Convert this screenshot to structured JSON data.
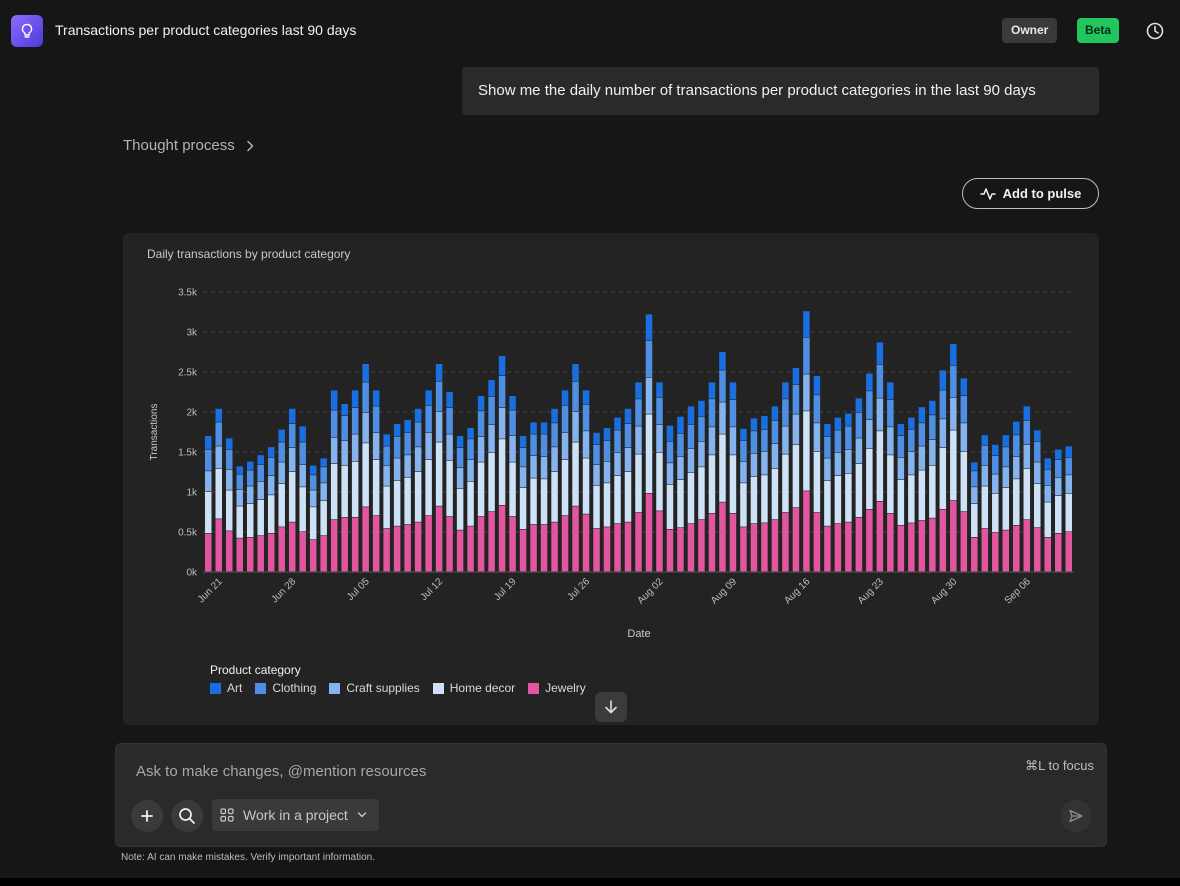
{
  "header": {
    "title": "Transactions per product categories last 90 days",
    "owner_badge": "Owner",
    "beta_badge": "Beta"
  },
  "conversation": {
    "user_message": "Show me the daily number of transactions per product categories in the last 90 days",
    "thought_process_label": "Thought process",
    "add_to_pulse_label": "Add to pulse"
  },
  "chart_data": {
    "type": "bar",
    "stacked": true,
    "title": "Daily transactions by product category",
    "xlabel": "Date",
    "ylabel": "Transactions",
    "ylim": [
      0,
      3500
    ],
    "yticks": [
      "0k",
      "0.5k",
      "1k",
      "1.5k",
      "2k",
      "2.5k",
      "3k",
      "3.5k"
    ],
    "ytick_values": [
      0,
      500,
      1000,
      1500,
      2000,
      2500,
      3000,
      3500
    ],
    "xtick_labels": [
      "Jun 21",
      "Jun 28",
      "Jul 05",
      "Jul 12",
      "Jul 19",
      "Jul 26",
      "Aug 02",
      "Aug 09",
      "Aug 16",
      "Aug 23",
      "Aug 30",
      "Sep 06"
    ],
    "xtick_indices": [
      1,
      8,
      15,
      22,
      29,
      36,
      43,
      50,
      57,
      64,
      71,
      78
    ],
    "grid": true,
    "legend_title": "Product category",
    "legend_position": "bottom-left",
    "colors": {
      "Art": "#1a6fe0",
      "Clothing": "#4e8fe3",
      "Craft supplies": "#84b3ee",
      "Home decor": "#cde1f7",
      "Jewelry": "#e2559f"
    },
    "totals": [
      1700,
      2040,
      1670,
      1320,
      1380,
      1460,
      1560,
      1780,
      2040,
      1820,
      1330,
      1420,
      2270,
      2100,
      2270,
      2600,
      2270,
      1720,
      1850,
      1900,
      2040,
      2270,
      2600,
      2250,
      1700,
      1800,
      2200,
      2400,
      2700,
      2200,
      1700,
      1870,
      1870,
      2040,
      2270,
      2600,
      2270,
      1740,
      1800,
      1930,
      2040,
      2370,
      3220,
      2370,
      1830,
      1940,
      2070,
      2140,
      2370,
      2750,
      2370,
      1790,
      1920,
      1950,
      2070,
      2370,
      2550,
      3260,
      2450,
      1850,
      1930,
      1980,
      2170,
      2480,
      2870,
      2370,
      1850,
      1930,
      2060,
      2140,
      2500,
      2850,
      2420,
      1370,
      1710,
      1590,
      1710,
      1880,
      2070,
      1770,
      1420,
      1530,
      1570
    ],
    "series": [
      {
        "name": "Jewelry",
        "values": [
          480,
          660,
          510,
          420,
          430,
          450,
          480,
          560,
          620,
          500,
          400,
          450,
          650,
          680,
          680,
          810,
          700,
          540,
          570,
          590,
          620,
          700,
          820,
          690,
          520,
          570,
          690,
          750,
          830,
          690,
          530,
          590,
          590,
          620,
          700,
          820,
          720,
          540,
          560,
          600,
          620,
          740,
          980,
          760,
          530,
          550,
          600,
          650,
          730,
          870,
          730,
          560,
          600,
          610,
          650,
          740,
          800,
          1010,
          740,
          570,
          600,
          620,
          680,
          780,
          880,
          730,
          580,
          610,
          640,
          670,
          780,
          890,
          750,
          430,
          540,
          490,
          520,
          580,
          650,
          550,
          430,
          480,
          500
        ]
      },
      {
        "name": "Home decor",
        "values": [
          520,
          630,
          510,
          400,
          420,
          450,
          480,
          540,
          630,
          560,
          410,
          440,
          700,
          650,
          700,
          800,
          700,
          530,
          570,
          590,
          630,
          700,
          800,
          700,
          520,
          560,
          680,
          740,
          830,
          680,
          520,
          580,
          570,
          630,
          700,
          800,
          700,
          540,
          550,
          600,
          630,
          730,
          990,
          730,
          560,
          600,
          640,
          660,
          730,
          850,
          730,
          550,
          590,
          600,
          640,
          730,
          790,
          1000,
          760,
          570,
          600,
          610,
          670,
          760,
          880,
          730,
          570,
          600,
          630,
          660,
          770,
          880,
          750,
          420,
          530,
          490,
          530,
          580,
          640,
          550,
          440,
          470,
          480
        ]
      },
      {
        "name": "Craft supplies",
        "values": [
          260,
          280,
          260,
          210,
          220,
          230,
          240,
          270,
          300,
          280,
          210,
          220,
          330,
          310,
          340,
          380,
          340,
          260,
          280,
          280,
          310,
          340,
          380,
          330,
          260,
          270,
          320,
          350,
          390,
          330,
          260,
          280,
          280,
          310,
          340,
          380,
          340,
          260,
          270,
          290,
          300,
          350,
          460,
          350,
          270,
          290,
          300,
          320,
          350,
          400,
          350,
          270,
          290,
          290,
          310,
          350,
          380,
          460,
          360,
          280,
          290,
          300,
          320,
          360,
          410,
          350,
          280,
          290,
          300,
          320,
          360,
          410,
          360,
          210,
          260,
          240,
          260,
          280,
          300,
          270,
          210,
          230,
          230
        ]
      },
      {
        "name": "Clothing",
        "values": [
          270,
          300,
          250,
          190,
          200,
          210,
          230,
          250,
          300,
          280,
          190,
          200,
          340,
          310,
          330,
          380,
          330,
          240,
          270,
          280,
          310,
          340,
          380,
          330,
          250,
          260,
          320,
          350,
          400,
          320,
          240,
          270,
          280,
          300,
          340,
          380,
          330,
          250,
          260,
          280,
          300,
          340,
          460,
          340,
          270,
          290,
          300,
          310,
          350,
          400,
          340,
          260,
          280,
          280,
          290,
          340,
          370,
          460,
          350,
          270,
          280,
          290,
          320,
          360,
          420,
          340,
          270,
          280,
          290,
          310,
          360,
          400,
          340,
          200,
          250,
          230,
          250,
          270,
          300,
          260,
          200,
          220,
          220
        ]
      },
      {
        "name": "Art",
        "values": [
          170,
          170,
          140,
          100,
          110,
          120,
          130,
          160,
          190,
          200,
          120,
          110,
          250,
          150,
          220,
          230,
          200,
          150,
          160,
          160,
          170,
          190,
          220,
          200,
          150,
          140,
          190,
          210,
          250,
          180,
          150,
          150,
          150,
          180,
          190,
          220,
          180,
          150,
          160,
          160,
          190,
          210,
          330,
          190,
          200,
          210,
          230,
          200,
          210,
          230,
          220,
          150,
          160,
          170,
          180,
          210,
          210,
          330,
          240,
          160,
          160,
          160,
          180,
          220,
          280,
          220,
          150,
          150,
          200,
          180,
          250,
          270,
          220,
          110,
          130,
          140,
          150,
          170,
          180,
          140,
          140,
          130,
          140
        ]
      }
    ]
  },
  "composer": {
    "placeholder": "Ask to make changes, @mention resources",
    "shortcut_hint": "⌘L to focus",
    "project_label": "Work in a project"
  },
  "footer": {
    "note": "Note: AI can make mistakes. Verify important information."
  }
}
